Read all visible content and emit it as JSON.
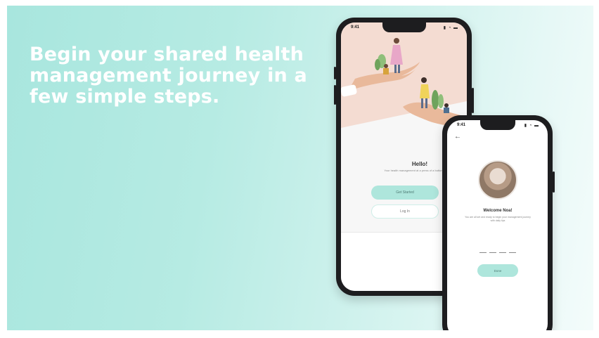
{
  "headline": "Begin your shared health management journey in a few simple steps.",
  "colors": {
    "accent": "#aee6dc",
    "background_start": "#a8e6de",
    "background_end": "#f4fcfb",
    "headline": "#ffffff"
  },
  "phone_main": {
    "status_time": "9:41",
    "status_icons": "signal-wifi-battery-icons",
    "hello_title": "Hello!",
    "hello_subtitle": "Your health management at a press of a button",
    "get_started_label": "Get Started",
    "login_label": "Log In"
  },
  "phone_secondary": {
    "status_time": "9:41",
    "back_icon": "arrow-left-icon",
    "welcome_title": "Welcome Noa!",
    "welcome_subtitle": "You are all set and ready to begin your management journey with daily tips",
    "done_label": "Done"
  }
}
